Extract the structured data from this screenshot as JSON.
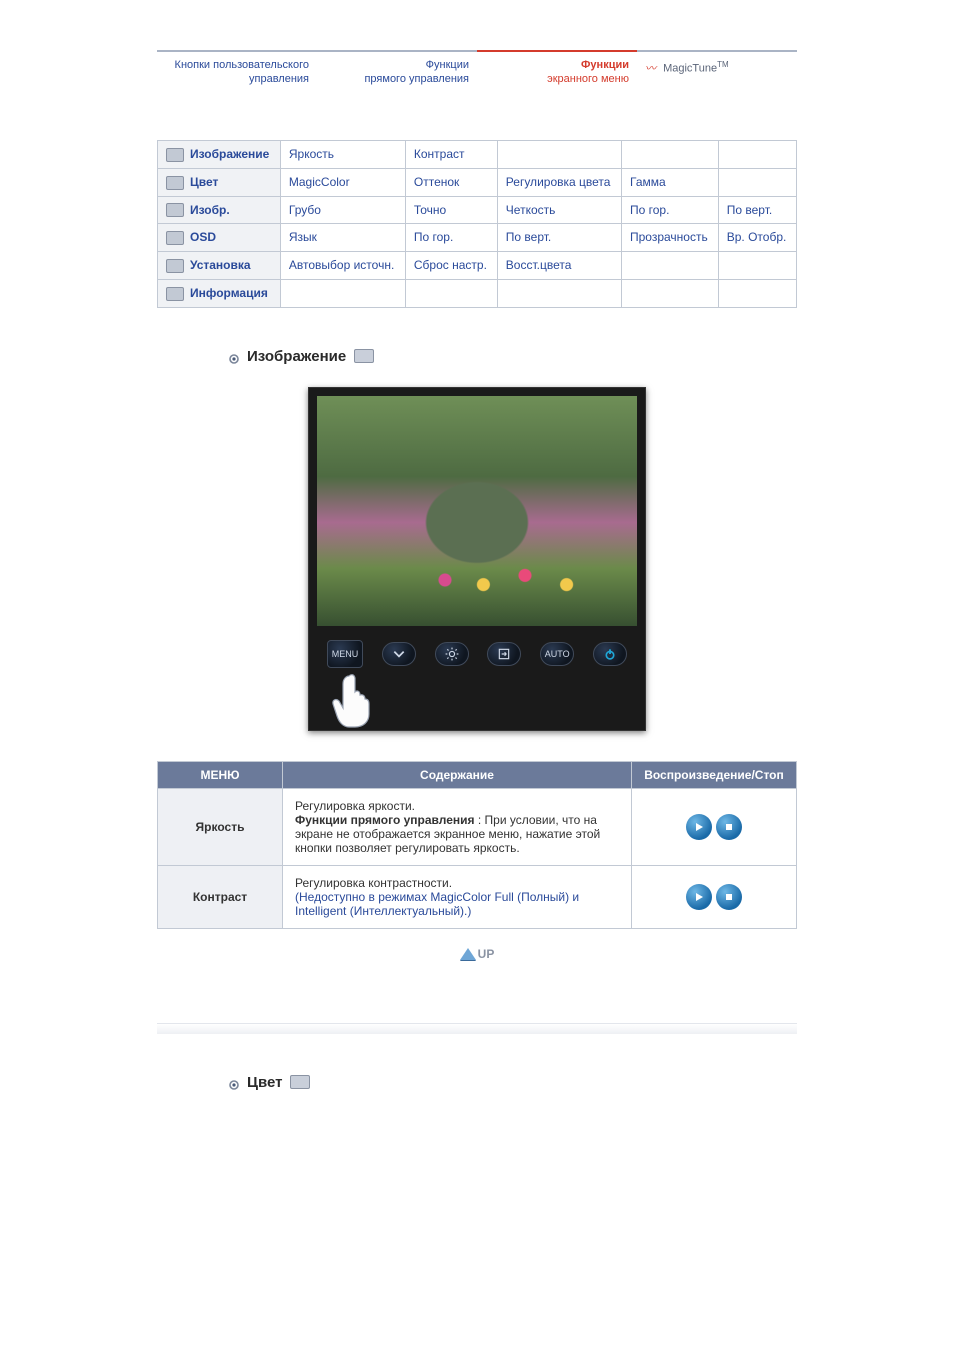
{
  "tabs": {
    "t1": {
      "line1": "Кнопки пользовательского",
      "line2": "управления"
    },
    "t2": {
      "line1": "Функции",
      "line2": "прямого управления"
    },
    "t3": {
      "line1": "Функции",
      "line2": "экранного меню"
    },
    "t4": {
      "label": "MagicTune",
      "tm": "TM"
    }
  },
  "grid": {
    "rows": [
      {
        "head": "Изображение",
        "icon": "picture-icon",
        "cells": [
          "Яркость",
          "Контраст",
          "",
          "",
          ""
        ]
      },
      {
        "head": "Цвет",
        "icon": "color-icon",
        "cells": [
          "MagicColor",
          "Оттенок",
          "Регулировка цвета",
          "Гамма",
          ""
        ]
      },
      {
        "head": "Изобр.",
        "icon": "image-icon",
        "cells": [
          "Грубо",
          "Точно",
          "Четкость",
          "По гор.",
          "По верт."
        ]
      },
      {
        "head": "OSD",
        "icon": "osd-icon",
        "cells": [
          "Язык",
          "По гор.",
          "По верт.",
          "Прозрачность",
          "Вр. Отобр."
        ]
      },
      {
        "head": "Установка",
        "icon": "setup-icon",
        "cells": [
          "Автовыбор источн.",
          "Сброс настр.",
          "Восст.цвета",
          "",
          ""
        ]
      },
      {
        "head": "Информация",
        "icon": "info-icon",
        "cells": [
          "",
          "",
          "",
          "",
          ""
        ]
      }
    ]
  },
  "section1": {
    "title": "Изображение"
  },
  "osd_buttons": {
    "menu": "MENU",
    "auto": "AUTO"
  },
  "menu_table": {
    "headers": {
      "c1": "МЕНЮ",
      "c2": "Содержание",
      "c3": "Воспроизведение/Стоп"
    },
    "rows": [
      {
        "name": "Яркость",
        "desc_plain": "Регулировка яркости.",
        "desc_bold": "Функции прямого управления",
        "desc_rest": " : При условии, что на экране не отображается экранное меню, нажатие этой кнопки позволяет регулировать яркость.",
        "note": ""
      },
      {
        "name": "Контраст",
        "desc_plain": "Регулировка контрастности.",
        "desc_bold": "",
        "desc_rest": "",
        "note": "(Недоступно в режимах MagicColor Full (Полный) и Intelligent (Интеллектуальный).)"
      }
    ]
  },
  "up": {
    "label": "UP"
  },
  "section2": {
    "title": "Цвет"
  }
}
